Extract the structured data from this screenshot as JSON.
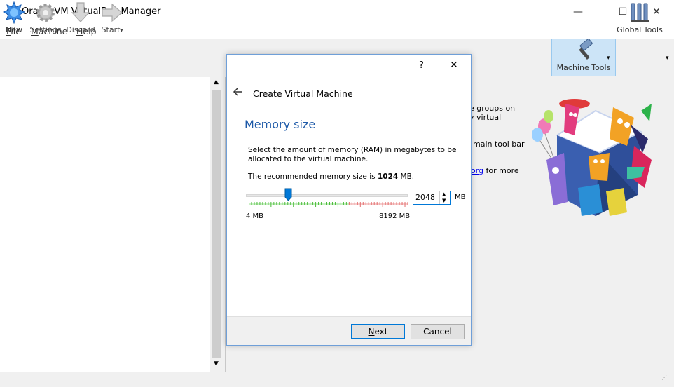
{
  "window": {
    "title": "Oracle VM VirtualBox Manager",
    "minimize": "—",
    "maximize": "☐",
    "close": "✕"
  },
  "menu": {
    "file_u": "F",
    "file_rest": "ile",
    "machine_u": "M",
    "machine_rest": "achine",
    "help_u": "H",
    "help_rest": "elp"
  },
  "toolbar": {
    "new": "New",
    "settings": "Settings",
    "discard": "Discard",
    "start": "Start",
    "machine_tools": "Machine Tools",
    "global_tools": "Global Tools"
  },
  "welcome": {
    "line1": "e groups on",
    "line2": "y virtual",
    "line3": "main tool bar",
    "link": "org",
    "line4": " for more"
  },
  "dialog": {
    "help": "?",
    "close": "✕",
    "title": "Create Virtual Machine",
    "heading": "Memory size",
    "desc_line1": "Select the amount of memory (RAM) in megabytes to be",
    "desc_line2": "allocated to the virtual machine.",
    "recommend_prefix": "The recommended memory size is ",
    "recommend_value": "1024",
    "recommend_suffix": " MB.",
    "memory": {
      "value": "2048",
      "unit": "MB",
      "min_label": "4 MB",
      "max_label": "8192 MB",
      "min": 4,
      "max": 8192,
      "current": 2048
    },
    "next": "Next",
    "next_u": "N",
    "next_rest": "ext",
    "cancel": "Cancel"
  },
  "colors": {
    "accent": "#0078d7",
    "heading": "#1e5aa8",
    "tick_green": "#4cbb3b",
    "tick_red": "#e36c6c",
    "selected_tool_bg": "#cce4f7"
  }
}
